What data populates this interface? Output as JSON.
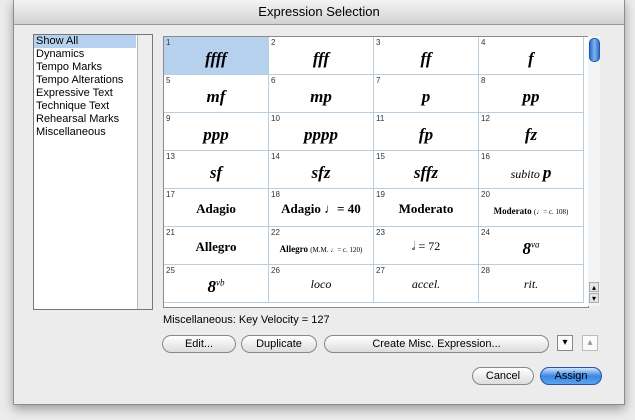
{
  "window": {
    "title": "Expression Selection"
  },
  "categories": {
    "items": [
      "Show All",
      "Dynamics",
      "Tempo Marks",
      "Tempo Alterations",
      "Expressive Text",
      "Technique Text",
      "Rehearsal Marks",
      "Miscellaneous"
    ],
    "selected": "Show All"
  },
  "cells": [
    {
      "n": "1",
      "t": "ffff"
    },
    {
      "n": "2",
      "t": "fff"
    },
    {
      "n": "3",
      "t": "ff"
    },
    {
      "n": "4",
      "t": "f"
    },
    {
      "n": "5",
      "t": "mf"
    },
    {
      "n": "6",
      "t": "mp"
    },
    {
      "n": "7",
      "t": "p"
    },
    {
      "n": "8",
      "t": "pp"
    },
    {
      "n": "9",
      "t": "ppp"
    },
    {
      "n": "10",
      "t": "pppp"
    },
    {
      "n": "11",
      "t": "fp"
    },
    {
      "n": "12",
      "t": "fz"
    },
    {
      "n": "13",
      "t": "sf"
    },
    {
      "n": "14",
      "t": "sfz"
    },
    {
      "n": "15",
      "t": "sffz"
    },
    {
      "n": "16",
      "a": "subito",
      "b": "p"
    },
    {
      "n": "17",
      "t": "Adagio"
    },
    {
      "n": "18",
      "t": "Adagio ♩= 40"
    },
    {
      "n": "19",
      "t": "Moderato"
    },
    {
      "n": "20",
      "a": "Moderato",
      "b": "(♩= c. 108)"
    },
    {
      "n": "21",
      "t": "Allegro"
    },
    {
      "n": "22",
      "a": "Allegro",
      "b": "(M.M. ♩= c. 120)"
    },
    {
      "n": "23",
      "t": "𝅗𝅥 = 72"
    },
    {
      "n": "24",
      "a": "8",
      "b": "va"
    },
    {
      "n": "25",
      "a": "8",
      "b": "vb"
    },
    {
      "n": "26",
      "t": "loco"
    },
    {
      "n": "27",
      "t": "accel."
    },
    {
      "n": "28",
      "t": "rit."
    }
  ],
  "status_text": "Miscellaneous: Key Velocity = 127",
  "buttons": {
    "edit": "Edit...",
    "duplicate": "Duplicate",
    "create": "Create Misc. Expression...",
    "cancel": "Cancel",
    "assign": "Assign"
  },
  "icons": {
    "move_down": "▾",
    "move_up": "▴",
    "scroll_up": "▴",
    "scroll_down": "▾"
  },
  "colors": {
    "selection": "#b6d1ee",
    "accent": "#3b87e2"
  }
}
